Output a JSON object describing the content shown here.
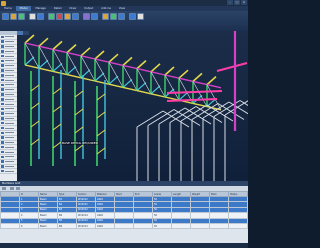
{
  "window": {
    "title": "",
    "minimize_glyph": "–",
    "maximize_glyph": "□",
    "close_glyph": "×"
  },
  "ribbon_tabs": [
    {
      "label": "Home",
      "active": false
    },
    {
      "label": "Model",
      "active": true
    },
    {
      "label": "Manage",
      "active": false
    },
    {
      "label": "Detail",
      "active": false
    },
    {
      "label": "Draw",
      "active": false
    },
    {
      "label": "Output",
      "active": false
    },
    {
      "label": "Add-ins",
      "active": false
    },
    {
      "label": "View",
      "active": false
    }
  ],
  "ribbon_groups": [
    {
      "label": "",
      "colors": [
        "#3c7bd1",
        "#d9a43b",
        "#4bbf73"
      ]
    },
    {
      "label": "",
      "colors": [
        "#e0e0e0",
        "#3c7bd1"
      ]
    },
    {
      "label": "",
      "colors": [
        "#4bbf73",
        "#cf4b4b",
        "#d9a43b",
        "#3c7bd1"
      ]
    },
    {
      "label": "",
      "colors": [
        "#8a6fd1",
        "#3c7bd1"
      ]
    },
    {
      "label": "",
      "colors": [
        "#d9a43b",
        "#4bbf73",
        "#3c7bd1"
      ]
    },
    {
      "label": "",
      "colors": [
        "#3c7bd1",
        "#e0e0e0"
      ]
    }
  ],
  "left_panel": {
    "title": "",
    "rows": 29
  },
  "viewport": {
    "tabs": [
      {
        "label": "",
        "active": true
      },
      {
        "label": "",
        "active": false
      }
    ],
    "callout": "BASE DETAIL REQUIRED",
    "colors": {
      "background": "#142640",
      "steel_yellow": "#e4d84a",
      "steel_green": "#3fd16a",
      "steel_magenta": "#d640c8",
      "steel_cyan": "#43c6e0",
      "steel_white": "#d8dde6",
      "selection": "#ff3da8"
    }
  },
  "bottom_panel": {
    "title": "Members Grid",
    "toolbar_label": "",
    "columns": [
      "",
      "#",
      "Name",
      "Type",
      "Section",
      "Material",
      "Start",
      "End",
      "Grade",
      "Length",
      "Weight",
      "Mark",
      "Status"
    ],
    "rows": [
      {
        "selected": true,
        "cells": [
          "",
          "1",
          "Beam",
          "B1",
          "W10X12",
          "A992",
          "",
          "",
          "50",
          "",
          "",
          "",
          ""
        ]
      },
      {
        "selected": true,
        "cells": [
          "",
          "2",
          "Beam",
          "B2",
          "W10X12",
          "A992",
          "",
          "",
          "50",
          "",
          "",
          "",
          ""
        ]
      },
      {
        "selected": true,
        "cells": [
          "",
          "3",
          "Beam",
          "B3",
          "W10X12",
          "A992",
          "",
          "",
          "50",
          "",
          "",
          "",
          ""
        ]
      },
      {
        "selected": false,
        "cells": [
          "",
          "4",
          "Beam",
          "B4",
          "W12X14",
          "A992",
          "",
          "",
          "50",
          "",
          "",
          "",
          ""
        ]
      },
      {
        "selected": true,
        "cells": [
          "",
          "5",
          "Beam",
          "B5",
          "W12X14",
          "A992",
          "",
          "",
          "50",
          "",
          "",
          "",
          ""
        ]
      },
      {
        "selected": false,
        "cells": [
          "",
          "6",
          "Beam",
          "B6",
          "W12X14",
          "A992",
          "",
          "",
          "50",
          "",
          "",
          "",
          ""
        ]
      }
    ]
  },
  "status_bar": {
    "text": ""
  }
}
